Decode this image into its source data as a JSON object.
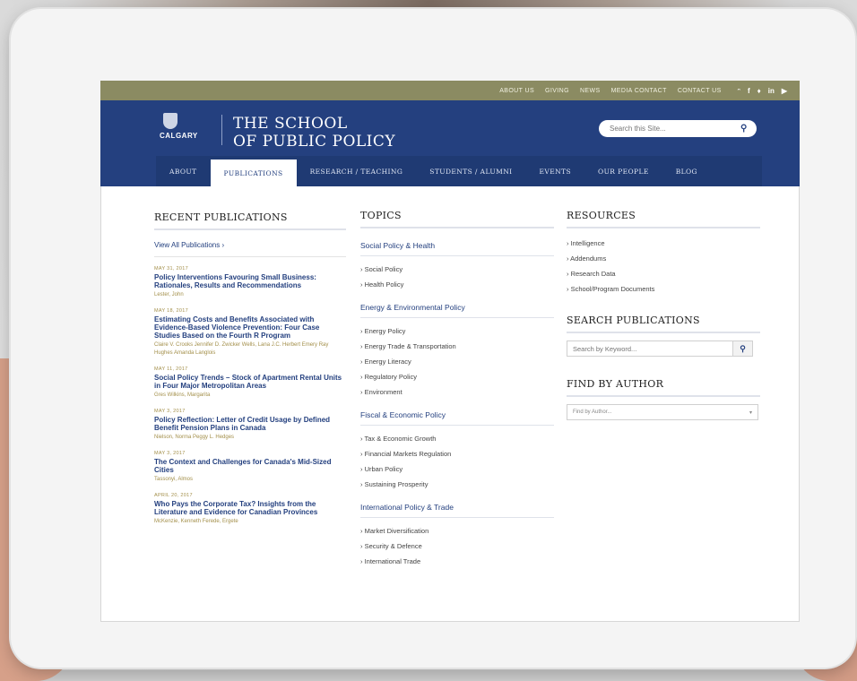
{
  "utility_bar": {
    "links": [
      "ABOUT US",
      "GIVING",
      "NEWS",
      "MEDIA CONTACT",
      "CONTACT US"
    ],
    "social_icons": [
      "rss-icon",
      "facebook-icon",
      "twitter-icon",
      "linkedin-icon",
      "youtube-icon"
    ]
  },
  "header": {
    "uc_name": "CALGARY",
    "school_line1": "THE SCHOOL",
    "school_line2": "OF PUBLIC POLICY",
    "search_placeholder": "Search this Site..."
  },
  "nav": {
    "items": [
      "ABOUT",
      "PUBLICATIONS",
      "RESEARCH / TEACHING",
      "STUDENTS / ALUMNI",
      "EVENTS",
      "OUR PEOPLE",
      "BLOG"
    ],
    "active": "PUBLICATIONS"
  },
  "recent": {
    "title": "RECENT PUBLICATIONS",
    "view_all": "View All Publications ›",
    "items": [
      {
        "date": "MAY 31, 2017",
        "title": "Policy Interventions Favouring Small Business: Rationales, Results and Recommendations",
        "authors": "Lester, John"
      },
      {
        "date": "MAY 18, 2017",
        "title": "Estimating Costs and Benefits Associated with Evidence-Based Violence Prevention: Four Case Studies Based on the Fourth R Program",
        "authors": "Claire V. Crooks   Jennifer D. Zwicker   Wells, Lana   J.C. Herbert Emery   Ray Hughes   Amanda Langlois"
      },
      {
        "date": "MAY 11, 2017",
        "title": "Social Policy Trends – Stock of Apartment Rental Units in Four Major Metropolitan Areas",
        "authors": "Gres Wilkins, Margarita"
      },
      {
        "date": "MAY 3, 2017",
        "title": "Policy Reflection: Letter of Credit Usage by Defined Benefit Pension Plans in Canada",
        "authors": "Nielson, Norma   Peggy L. Hedges"
      },
      {
        "date": "MAY 3, 2017",
        "title": "The Context and Challenges for Canada's Mid-Sized Cities",
        "authors": "Tassonyi, Almos"
      },
      {
        "date": "APRIL 20, 2017",
        "title": "Who Pays the Corporate Tax? Insights from the Literature and Evidence for Canadian Provinces",
        "authors": "McKenzie, Kenneth   Ferede, Ergete"
      }
    ]
  },
  "topics": {
    "title": "TOPICS",
    "groups": [
      {
        "heading": "Social Policy & Health",
        "items": [
          "› Social Policy",
          "› Health Policy"
        ]
      },
      {
        "heading": "Energy & Environmental Policy",
        "items": [
          "› Energy Policy",
          "› Energy Trade & Transportation",
          "› Energy Literacy",
          "› Regulatory Policy",
          "› Environment"
        ]
      },
      {
        "heading": "Fiscal & Economic Policy",
        "items": [
          "› Tax & Economic Growth",
          "› Financial Markets Regulation",
          "› Urban Policy",
          "› Sustaining Prosperity"
        ]
      },
      {
        "heading": "International Policy & Trade",
        "items": [
          "› Market Diversification",
          "› Security & Defence",
          "› International Trade"
        ]
      }
    ]
  },
  "resources": {
    "title": "RESOURCES",
    "items": [
      "› Intelligence",
      "› Addendums",
      "› Research Data",
      "› School/Program Documents"
    ]
  },
  "search_publications": {
    "title": "SEARCH PUBLICATIONS",
    "placeholder": "Search by Keyword..."
  },
  "find_by_author": {
    "title": "FIND BY AUTHOR",
    "placeholder": "Find by Author..."
  },
  "colors": {
    "brand_blue": "#24407f",
    "utility_olive": "#8b8b62",
    "meta_gold": "#a38f4a"
  }
}
